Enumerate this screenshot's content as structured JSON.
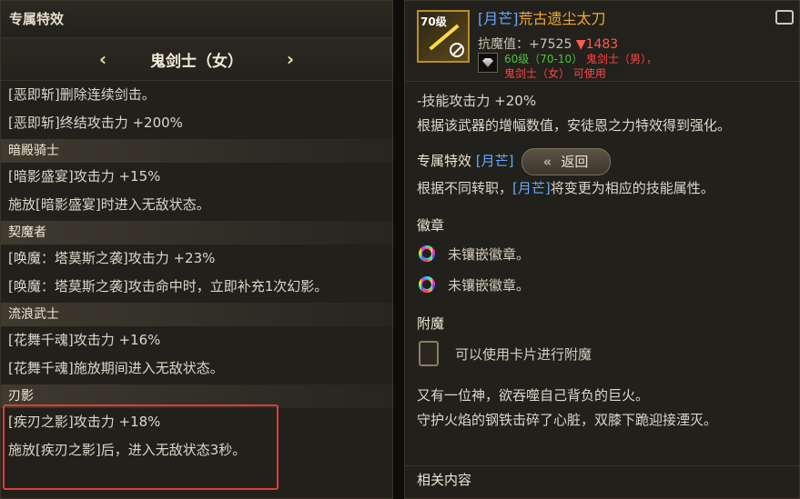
{
  "left": {
    "title": "专属特效",
    "selector": {
      "prev": "‹",
      "name": "鬼剑士（女）",
      "next": "›"
    },
    "intro": [
      "[恶即斩]删除连续剑击。",
      "[恶即斩]终结攻击力 +200%"
    ],
    "groups": [
      {
        "name": "暗殿骑士",
        "lines": [
          "[暗影盛宴]攻击力 +15%",
          "施放[暗影盛宴]时进入无敌状态。"
        ]
      },
      {
        "name": "契魔者",
        "lines": [
          "[唤魔：塔莫斯之袭]攻击力 +23%",
          "[唤魔：塔莫斯之袭]攻击命中时，立即补充1次幻影。"
        ]
      },
      {
        "name": "流浪武士",
        "lines": [
          "[花舞千魂]攻击力 +16%",
          "[花舞千魂]施放期间进入无敌状态。"
        ]
      },
      {
        "name": "刃影",
        "lines": [
          "[疾刃之影]攻击力 +18%",
          "施放[疾刃之影]后，进入无敌状态3秒。"
        ]
      }
    ]
  },
  "right": {
    "item": {
      "level": "70级",
      "tag": "[月芒]",
      "name": "荒古遗尘太刀",
      "resist_label": "抗魔值：+7525",
      "resist_delta": "▼1483",
      "req_level": "60级（70-10）",
      "req_class1": "鬼剑士（男），",
      "req_class2": "鬼剑士（女） 可使用"
    },
    "skill_line": "-技能攻击力 +20%",
    "desc_line": "根据该武器的增幅数值，安徒恩之力特效得到强化。",
    "exclusive": {
      "label": "专属特效",
      "tag": "[月芒]",
      "back": "返回"
    },
    "transfer": {
      "pre": "根据不同转职，",
      "tag": "[月芒]",
      "post": "将变更为相应的技能属性。"
    },
    "emblem": {
      "title": "徽章",
      "slots": [
        "未镶嵌徽章。",
        "未镶嵌徽章。"
      ]
    },
    "enchant": {
      "title": "附魔",
      "text": "可以使用卡片进行附魔"
    },
    "flavor": [
      "又有一位神，欲吞噬自己背负的巨火。",
      "守护火焰的钢铁击碎了心脏，双膝下跪迎接湮灭。"
    ],
    "related": "相关内容"
  },
  "colors": {
    "highlight": "#e23b3b",
    "tag_blue": "#6aa7ff",
    "item_orange": "#f2a93b",
    "req_green": "#4ec23f",
    "req_red": "#ff4444"
  }
}
